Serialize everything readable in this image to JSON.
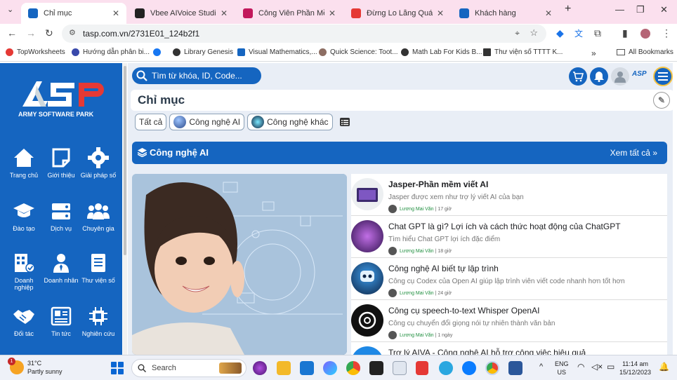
{
  "browser": {
    "tabs": [
      {
        "title": "Chỉ mục",
        "active": true,
        "favicon_color": "#1565c0"
      },
      {
        "title": "Vbee AIVoice Studio - Cô",
        "active": false,
        "favicon_color": "#222222"
      },
      {
        "title": "Công Viên Phần Mềm Q",
        "active": false,
        "favicon_color": "#c2185b"
      },
      {
        "title": "Đừng Lo Lắng Quá, Hãy",
        "active": false,
        "favicon_color": "#e53935"
      },
      {
        "title": "Khách hàng",
        "active": false,
        "favicon_color": "#1565c0"
      }
    ],
    "new_tab_label": "+",
    "url": "tasp.com.vn/2731E01_124b2f1",
    "bookmarks": [
      {
        "label": "TopWorksheets",
        "color": "#e53935"
      },
      {
        "label": "Hướng dẫn phân bi...",
        "color": "#3949ab"
      },
      {
        "label": "",
        "color": "#1877f2"
      },
      {
        "label": "Library Genesis",
        "color": "#333333"
      },
      {
        "label": "Visual Mathematics,...",
        "color": "#1565c0"
      },
      {
        "label": "Quick Science: Toot...",
        "color": "#8d6e63"
      },
      {
        "label": "Math Lab For Kids B...",
        "color": "#333333"
      },
      {
        "label": "Thư viện số TTTT K...",
        "color": "#333333"
      }
    ],
    "all_bookmarks": "All Bookmarks"
  },
  "sidebar": {
    "logo_text": "ARMY SOFTWARE PARK",
    "logo_letters": "ASP",
    "items": [
      {
        "label": "Trang chủ",
        "icon": "home-icon"
      },
      {
        "label": "Giới thiệu",
        "icon": "note-icon"
      },
      {
        "label": "Giải pháp số",
        "icon": "gear-icon"
      },
      {
        "label": "Đào tạo",
        "icon": "graduation-cap-icon"
      },
      {
        "label": "Dịch vụ",
        "icon": "server-icon"
      },
      {
        "label": "Chuyên gia",
        "icon": "users-icon"
      },
      {
        "label": "Doanh nghiệp",
        "icon": "building-icon"
      },
      {
        "label": "Doanh nhân",
        "icon": "businessman-icon"
      },
      {
        "label": "Thư viện số",
        "icon": "book-icon"
      },
      {
        "label": "Đối tác",
        "icon": "handshake-icon"
      },
      {
        "label": "Tin tức",
        "icon": "news-icon"
      },
      {
        "label": "Nghiên cứu",
        "icon": "chip-icon"
      }
    ]
  },
  "header": {
    "search_placeholder": "Tìm từ khóa, ID, Code...",
    "asp_mini": "ASP"
  },
  "page": {
    "title": "Chỉ mục",
    "chips": [
      {
        "label": "Tất cả"
      },
      {
        "label": "Công nghệ AI"
      },
      {
        "label": "Công nghệ khác"
      }
    ],
    "section_title": "Công nghệ AI",
    "section_more": "Xem tất cả"
  },
  "articles": [
    {
      "title": "Jasper-Phần mềm viết AI",
      "desc": "Jasper được xem như trợ lý viết AI của bạn",
      "author": "Lương Mai Văn",
      "time": "17 giờ",
      "bold": true
    },
    {
      "title": "Chat GPT là gì? Lợi ích và cách thức hoạt động của ChatGPT",
      "desc": "Tìm hiểu Chat GPT lợi ích đặc điểm",
      "author": "Lương Mai Văn",
      "time": "18 giờ",
      "bold": false
    },
    {
      "title": "Công nghệ AI biết tự lập trình",
      "desc": "Công cụ Codex của Open AI giúp lập trình viên viết code nhanh hơn tốt hơn",
      "author": "Lương Mai Văn",
      "time": "24 giờ",
      "bold": false
    },
    {
      "title": "Công cụ speech-to-text Whisper OpenAI",
      "desc": "Công cụ chuyển đổi giọng nói tự nhiên thành văn bản",
      "author": "Lương Mai Văn",
      "time": "1 ngày",
      "bold": false
    },
    {
      "title": "Trợ lý AIVA - Công nghệ AI hỗ trợ công việc hiệu quả",
      "desc": "",
      "author": "",
      "time": "",
      "bold": false
    }
  ],
  "taskbar": {
    "weather_temp": "31°C",
    "weather_desc": "Partly sunny",
    "weather_badge": "1",
    "search_label": "Search",
    "lang_top": "ENG",
    "lang_bottom": "US",
    "time": "11:14 am",
    "date": "15/12/2023"
  }
}
